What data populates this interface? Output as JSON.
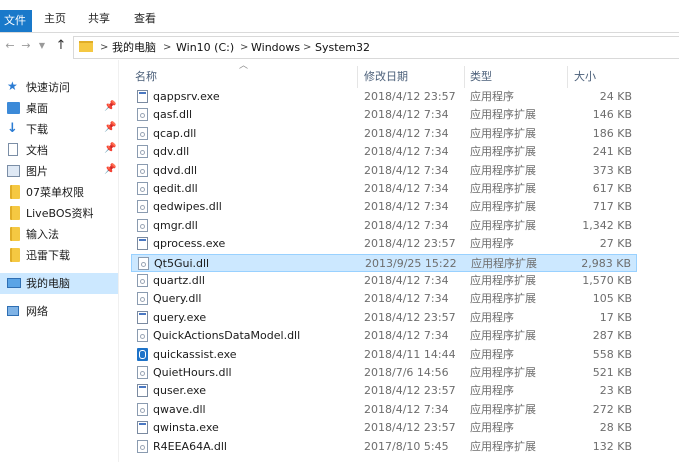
{
  "ribbon": {
    "tabs": [
      "文件",
      "主页",
      "共享",
      "查看"
    ]
  },
  "address": {
    "back_icon": "arrow-left-icon",
    "forward_icon": "arrow-right-icon",
    "history_icon": "chevron-down-icon",
    "up_icon": "arrow-up-icon",
    "crumbs": [
      "我的电脑",
      "Win10 (C:)",
      "Windows",
      "System32"
    ],
    "separator": ">"
  },
  "nav": {
    "items": [
      {
        "label": "快速访问",
        "icon": "star-icon",
        "pinned": false
      },
      {
        "label": "桌面",
        "icon": "desktop-icon",
        "pinned": true
      },
      {
        "label": "下载",
        "icon": "download-icon",
        "pinned": true
      },
      {
        "label": "文档",
        "icon": "document-icon",
        "pinned": true
      },
      {
        "label": "图片",
        "icon": "picture-icon",
        "pinned": true
      },
      {
        "label": "07菜单权限",
        "icon": "folder-icon",
        "pinned": false
      },
      {
        "label": "LiveBOS资料",
        "icon": "folder-icon",
        "pinned": false
      },
      {
        "label": "输入法",
        "icon": "folder-icon",
        "pinned": false
      },
      {
        "label": "迅雷下载",
        "icon": "folder-icon",
        "pinned": false
      },
      {
        "label": "我的电脑",
        "icon": "computer-icon",
        "pinned": false
      },
      {
        "label": "网络",
        "icon": "network-icon",
        "pinned": false
      }
    ],
    "pin_glyph": "📌"
  },
  "columns": {
    "name": "名称",
    "date": "修改日期",
    "type": "类型",
    "size": "大小"
  },
  "files": [
    {
      "name": "qappsrv.exe",
      "date": "2018/4/12 23:57",
      "type": "应用程序",
      "size": "24 KB",
      "icon": "exe"
    },
    {
      "name": "qasf.dll",
      "date": "2018/4/12 7:34",
      "type": "应用程序扩展",
      "size": "146 KB",
      "icon": "dll"
    },
    {
      "name": "qcap.dll",
      "date": "2018/4/12 7:34",
      "type": "应用程序扩展",
      "size": "186 KB",
      "icon": "dll"
    },
    {
      "name": "qdv.dll",
      "date": "2018/4/12 7:34",
      "type": "应用程序扩展",
      "size": "241 KB",
      "icon": "dll"
    },
    {
      "name": "qdvd.dll",
      "date": "2018/4/12 7:34",
      "type": "应用程序扩展",
      "size": "373 KB",
      "icon": "dll"
    },
    {
      "name": "qedit.dll",
      "date": "2018/4/12 7:34",
      "type": "应用程序扩展",
      "size": "617 KB",
      "icon": "dll"
    },
    {
      "name": "qedwipes.dll",
      "date": "2018/4/12 7:34",
      "type": "应用程序扩展",
      "size": "717 KB",
      "icon": "dll"
    },
    {
      "name": "qmgr.dll",
      "date": "2018/4/12 7:34",
      "type": "应用程序扩展",
      "size": "1,342 KB",
      "icon": "dll"
    },
    {
      "name": "qprocess.exe",
      "date": "2018/4/12 23:57",
      "type": "应用程序",
      "size": "27 KB",
      "icon": "exe"
    },
    {
      "name": "Qt5Gui.dll",
      "date": "2013/9/25 15:22",
      "type": "应用程序扩展",
      "size": "2,983 KB",
      "icon": "dll",
      "selected": true
    },
    {
      "name": "quartz.dll",
      "date": "2018/4/12 7:34",
      "type": "应用程序扩展",
      "size": "1,570 KB",
      "icon": "dll"
    },
    {
      "name": "Query.dll",
      "date": "2018/4/12 7:34",
      "type": "应用程序扩展",
      "size": "105 KB",
      "icon": "dll"
    },
    {
      "name": "query.exe",
      "date": "2018/4/12 23:57",
      "type": "应用程序",
      "size": "17 KB",
      "icon": "exe"
    },
    {
      "name": "QuickActionsDataModel.dll",
      "date": "2018/4/12 7:34",
      "type": "应用程序扩展",
      "size": "287 KB",
      "icon": "dll"
    },
    {
      "name": "quickassist.exe",
      "date": "2018/4/11 14:44",
      "type": "应用程序",
      "size": "558 KB",
      "icon": "qa"
    },
    {
      "name": "QuietHours.dll",
      "date": "2018/7/6 14:56",
      "type": "应用程序扩展",
      "size": "521 KB",
      "icon": "dll"
    },
    {
      "name": "quser.exe",
      "date": "2018/4/12 23:57",
      "type": "应用程序",
      "size": "23 KB",
      "icon": "exe"
    },
    {
      "name": "qwave.dll",
      "date": "2018/4/12 7:34",
      "type": "应用程序扩展",
      "size": "272 KB",
      "icon": "dll"
    },
    {
      "name": "qwinsta.exe",
      "date": "2018/4/12 23:57",
      "type": "应用程序",
      "size": "28 KB",
      "icon": "exe"
    },
    {
      "name": "R4EEA64A.dll",
      "date": "2017/8/10 5:45",
      "type": "应用程序扩展",
      "size": "132 KB",
      "icon": "dll"
    }
  ]
}
